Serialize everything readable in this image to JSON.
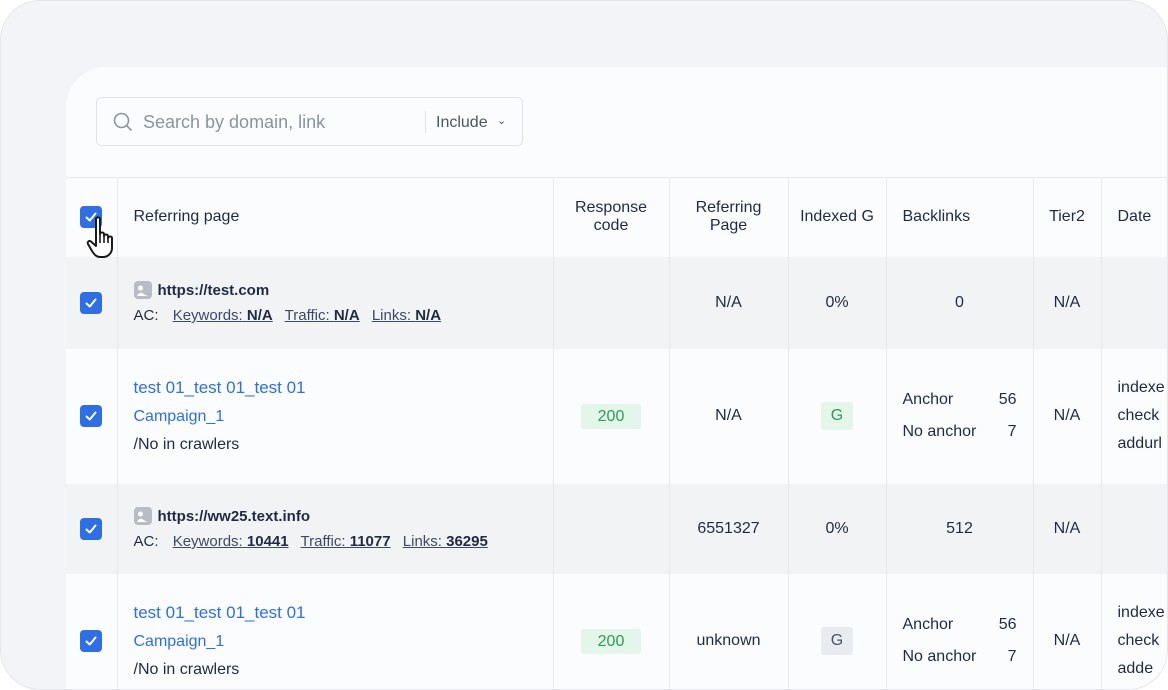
{
  "search": {
    "placeholder": "Search by domain, link",
    "filter_label": "Include"
  },
  "columns": {
    "referring_page": "Referring page",
    "response_code_1": "Response",
    "response_code_2": "code",
    "referring_page2_1": "Referring",
    "referring_page2_2": "Page",
    "indexed": "Indexed G",
    "backlinks": "Backlinks",
    "tier2": "Tier2",
    "date": "Date"
  },
  "rows": [
    {
      "domain": "https://test.com",
      "ac_label": "AC:",
      "keywords_label": "Keywords:",
      "keywords": "N/A",
      "traffic_label": "Traffic:",
      "traffic": "N/A",
      "links_label": "Links:",
      "links": "N/A",
      "referring_page": "N/A",
      "indexed": "0%",
      "backlinks": "0",
      "tier2": "N/A"
    },
    {
      "title": "test 01_test 01_test 01",
      "campaign": "Campaign_1",
      "note": "/No in crawlers",
      "response_code": "200",
      "referring_page": "N/A",
      "indexed": "G",
      "anchor_label": "Anchor",
      "anchor_count": "56",
      "no_anchor_label": "No anchor",
      "no_anchor_count": "7",
      "tier2": "N/A",
      "date_lines": [
        "indexe",
        "check",
        "addurl"
      ]
    },
    {
      "domain": "https://ww25.text.info",
      "ac_label": "AC:",
      "keywords_label": "Keywords:",
      "keywords": "10441",
      "traffic_label": "Traffic:",
      "traffic": "11077",
      "links_label": "Links:",
      "links": "36295",
      "referring_page": "6551327",
      "indexed": "0%",
      "backlinks": "512",
      "tier2": "N/A"
    },
    {
      "title": "test 01_test 01_test 01",
      "campaign": "Campaign_1",
      "note": "/No in crawlers",
      "response_code": "200",
      "referring_page": "unknown",
      "indexed": "G",
      "anchor_label": "Anchor",
      "anchor_count": "56",
      "no_anchor_label": "No anchor",
      "no_anchor_count": "7",
      "tier2": "N/A",
      "date_lines": [
        "indexe",
        "check",
        "adde"
      ]
    }
  ],
  "colors": {
    "accent": "#2f6fe4",
    "success_bg": "#e4f5ea",
    "success_text": "#2a9d5a"
  },
  "icons": {
    "search": "search-icon",
    "checkbox": "checkmark-icon",
    "cursor": "hand-pointer-icon",
    "image": "image-icon"
  }
}
